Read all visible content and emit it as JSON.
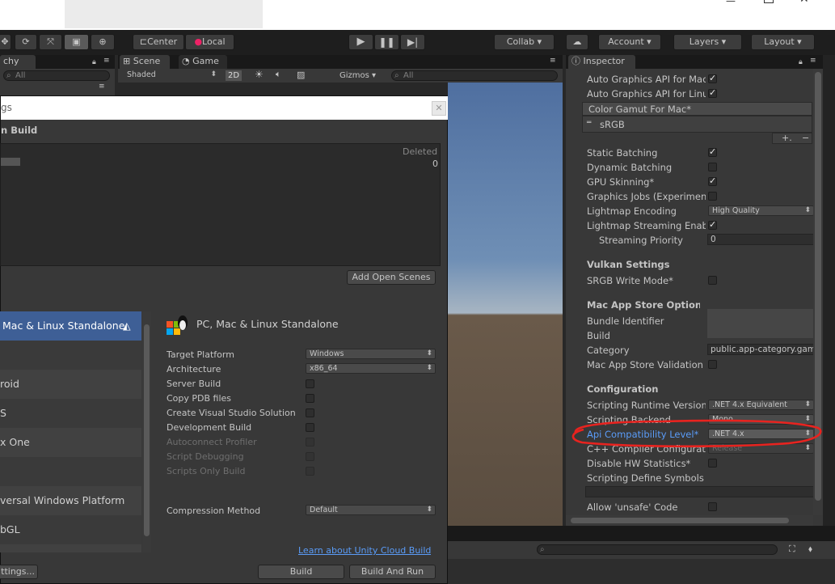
{
  "toolbar": {
    "pivot_label": "Center",
    "space_label": "Local",
    "collab_label": "Collab ▾",
    "account_label": "Account",
    "layers_label": "Layers",
    "layout_label": "Layout"
  },
  "hierarchy": {
    "tab_label": "chy",
    "search_placeholder": "All"
  },
  "scene": {
    "tab_scene": "Scene",
    "tab_game": "Game",
    "shading_mode": "Shaded",
    "mode_2d": "2D",
    "gizmos_label": "Gizmos",
    "search_placeholder": "All"
  },
  "build_settings": {
    "title": "gs",
    "scenes_header": "n Build",
    "deleted_label": "Deleted",
    "deleted_count": "0",
    "add_open_scenes": "Add Open Scenes",
    "platforms": [
      {
        "label": "Mac & Linux Standalone",
        "selected": true
      },
      {
        "label": ""
      },
      {
        "label": "roid"
      },
      {
        "label": "S"
      },
      {
        "label": "x One"
      },
      {
        "label": ""
      },
      {
        "label": "versal Windows Platform"
      },
      {
        "label": "bGL"
      }
    ],
    "platform_title": "PC, Mac & Linux Standalone",
    "target_platform_label": "Target Platform",
    "target_platform_value": "Windows",
    "architecture_label": "Architecture",
    "architecture_value": "x86_64",
    "server_build_label": "Server Build",
    "copy_pdb_label": "Copy PDB files",
    "create_vs_label": "Create Visual Studio Solution",
    "dev_build_label": "Development Build",
    "autoconnect_label": "Autoconnect Profiler",
    "script_debug_label": "Script Debugging",
    "scripts_only_label": "Scripts Only Build",
    "compression_label": "Compression Method",
    "compression_value": "Default",
    "cloud_build_link": "Learn about Unity Cloud Build",
    "player_settings_button": "ttings...",
    "build_button": "Build",
    "build_and_run_button": "Build And Run"
  },
  "inspector": {
    "tab_label": "Inspector",
    "auto_graphics_mac_label": "Auto Graphics API  for Mac",
    "auto_graphics_linux_label": "Auto Graphics API  for Linux",
    "color_gamut_header": "Color Gamut For Mac*",
    "color_gamut_item": "sRGB",
    "static_batching_label": "Static Batching",
    "dynamic_batching_label": "Dynamic Batching",
    "gpu_skinning_label": "GPU Skinning*",
    "graphics_jobs_label": "Graphics Jobs (Experimental)",
    "lightmap_encoding_label": "Lightmap Encoding",
    "lightmap_encoding_value": "High Quality",
    "lightmap_streaming_label": "Lightmap Streaming Enabled",
    "streaming_priority_label": "Streaming Priority",
    "streaming_priority_value": "0",
    "vulkan_header": "Vulkan Settings",
    "srgb_write_label": "SRGB Write Mode*",
    "mac_app_store_header": "Mac App Store Options",
    "bundle_id_label": "Bundle Identifier",
    "build_label": "Build",
    "category_label": "Category",
    "category_value": "public.app-category.games",
    "mas_validation_label": "Mac App Store Validation",
    "configuration_header": "Configuration",
    "scripting_runtime_label": "Scripting Runtime Version",
    "scripting_runtime_value": ".NET 4.x Equivalent",
    "scripting_backend_label": "Scripting Backend",
    "scripting_backend_value": "Mono",
    "api_compat_label": "Api Compatibility Level*",
    "api_compat_value": ".NET 4.x",
    "cpp_compiler_label": "C++ Compiler Configuration",
    "cpp_compiler_value": "Release",
    "disable_hw_label": "Disable HW Statistics*",
    "define_symbols_label": "Scripting Define Symbols",
    "allow_unsafe_label": "Allow 'unsafe' Code"
  },
  "colors": {
    "highlight_red": "#e8231f",
    "link_blue": "#5a9cf8",
    "selection_blue": "#3e5f96"
  }
}
